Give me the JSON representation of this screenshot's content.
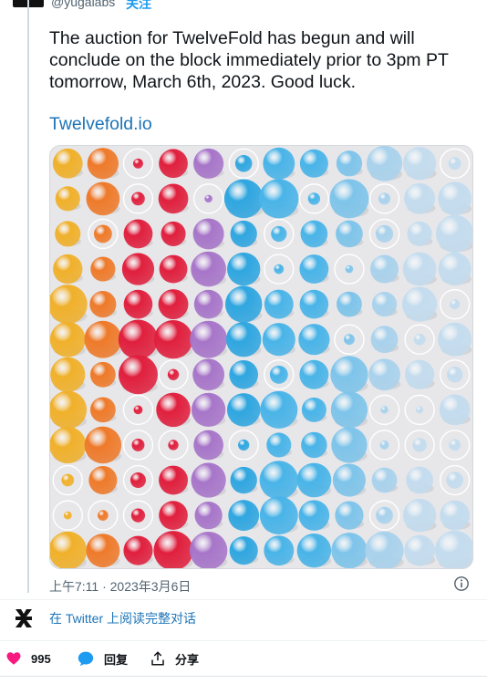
{
  "header": {
    "handle": "@yugalabs",
    "follow_label": "关注"
  },
  "tweet": {
    "text": "The auction for TwelveFold has begun and will conclude on the block immediately prior to 3pm PT tomorrow, March 6th, 2023. Good luck.",
    "link": "Twelvefold.io",
    "timestamp": "上午7:11 · 2023年3月6日"
  },
  "media": {
    "description_icon": "spheres-artwork-image",
    "palette": [
      "#f0b02a",
      "#ee7a2a",
      "#e01f3d",
      "#a775c9",
      "#2fa6e0",
      "#49b4e8",
      "#7ec4ea",
      "#a9d2ec",
      "#c3dcee"
    ]
  },
  "thread": {
    "link_label": "在 Twitter 上阅读完整对话"
  },
  "actions": {
    "likes": "995",
    "reply_label": "回复",
    "share_label": "分享"
  },
  "colors": {
    "accent": "#1d9bf0",
    "link": "#1d74b8",
    "like": "#f91880"
  }
}
